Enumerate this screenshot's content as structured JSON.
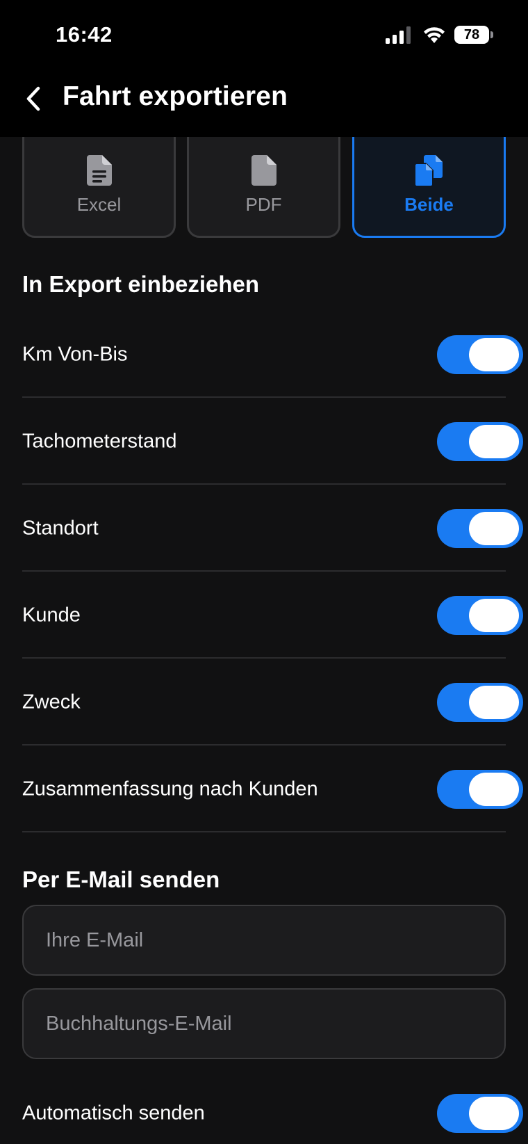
{
  "status_bar": {
    "time": "16:42",
    "battery": "78",
    "icons": [
      "cellular-signal-icon",
      "wifi-icon",
      "battery-icon"
    ]
  },
  "header": {
    "back_icon": "chevron-left-icon",
    "title": "Fahrt exportieren"
  },
  "formats": {
    "selected": "Beide",
    "items": [
      {
        "label": "Excel",
        "icon": "spreadsheet-file-icon"
      },
      {
        "label": "PDF",
        "icon": "file-icon"
      },
      {
        "label": "Beide",
        "icon": "multiple-files-icon"
      }
    ]
  },
  "include": {
    "title": "In Export einbeziehen",
    "items": [
      {
        "label": "Km Von-Bis",
        "on": true
      },
      {
        "label": "Tachometerstand",
        "on": true
      },
      {
        "label": "Standort",
        "on": true
      },
      {
        "label": "Kunde",
        "on": true
      },
      {
        "label": "Zweck",
        "on": true
      },
      {
        "label": "Zusammenfassung nach Kunden",
        "on": true
      }
    ]
  },
  "email": {
    "title": "Per E-Mail senden",
    "your_email": {
      "value": "",
      "placeholder": "Ihre E-Mail"
    },
    "accounting_email": {
      "value": "",
      "placeholder": "Buchhaltungs-E-Mail"
    },
    "auto_send": {
      "label": "Automatisch senden",
      "on": true
    }
  },
  "colors": {
    "accent": "#1a7bf2",
    "background": "#111112",
    "card": "#1c1c1e",
    "border": "#3a3a3c",
    "muted_text": "#98989d"
  }
}
